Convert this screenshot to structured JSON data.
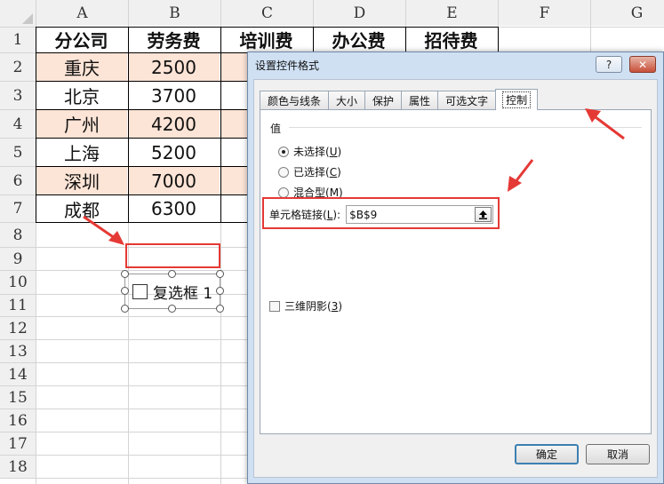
{
  "sheet": {
    "columns": [
      "A",
      "B",
      "C",
      "D",
      "E",
      "F",
      "G"
    ],
    "rows": [
      "1",
      "2",
      "3",
      "4",
      "5",
      "6",
      "7",
      "8",
      "9",
      "10",
      "11",
      "12",
      "13",
      "14",
      "15",
      "16",
      "17",
      "18"
    ],
    "headers": [
      "分公司",
      "劳务费",
      "培训费",
      "办公费",
      "招待费"
    ],
    "data": [
      [
        "重庆",
        "2500"
      ],
      [
        "北京",
        "3700"
      ],
      [
        "广州",
        "4200"
      ],
      [
        "上海",
        "5200"
      ],
      [
        "深圳",
        "7000"
      ],
      [
        "成都",
        "6300"
      ]
    ],
    "checkbox_control": {
      "label": "复选框 1"
    },
    "colors": {
      "highlight": "#fce4d6",
      "annotation": "#e53935"
    }
  },
  "dialog": {
    "title": "设置控件格式",
    "help_button": "?",
    "close_button": "✕",
    "tabs": [
      "颜色与线条",
      "大小",
      "保护",
      "属性",
      "可选文字",
      "控制"
    ],
    "active_tab": "控制",
    "value_group_label": "值",
    "radios": [
      {
        "text": "未选择(",
        "key": "U",
        "end": ")",
        "checked": true
      },
      {
        "text": "已选择(",
        "key": "C",
        "end": ")",
        "checked": false
      },
      {
        "text": "混合型(",
        "key": "M",
        "end": ")",
        "checked": false
      }
    ],
    "cell_link": {
      "label": "单元格链接(",
      "key": "L",
      "end": "):",
      "value": "$B$9"
    },
    "shading": {
      "label": "三维阴影(",
      "key": "3",
      "end": ")",
      "checked": false
    },
    "ok_button": "确定",
    "cancel_button": "取消",
    "colors": {
      "frame": "#cfe0f3",
      "default_button_border": "#3c7fb1"
    }
  }
}
